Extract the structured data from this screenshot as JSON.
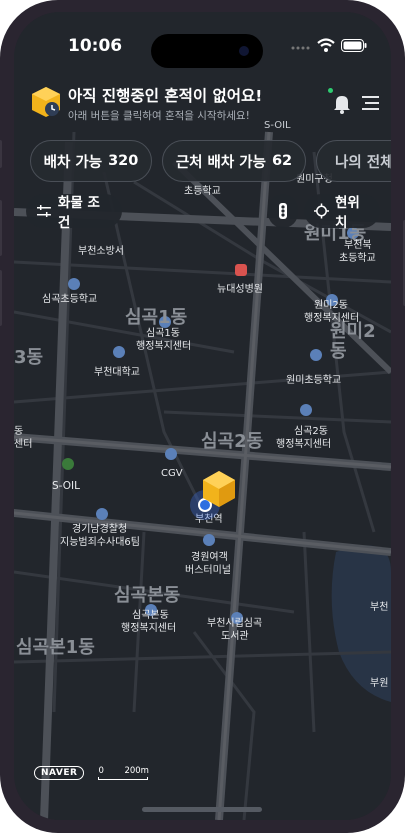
{
  "status_bar": {
    "time": "10:06"
  },
  "header": {
    "title": "아직 진행중인 혼적이 없어요!",
    "subtitle": "아래 버튼을 클릭하여 혼적을 시작하세요!"
  },
  "chips": [
    {
      "label": "배차 가능",
      "count": "320"
    },
    {
      "label": "근처 배차 가능",
      "count": "62"
    },
    {
      "label": "나의 전체",
      "count": ""
    }
  ],
  "toolbar": {
    "filter_label": "화물 조건",
    "location_label": "현위치"
  },
  "map": {
    "colors": {
      "land": "#22262c",
      "road": "#4a4e55",
      "main_road": "#5e6166",
      "label": "#e8eaed",
      "district": "#8a8f96",
      "poi_icon": "#5b80b8",
      "hospital": "#d9534f",
      "water": "#283446"
    },
    "places": {
      "oil_top": "S-OIL",
      "mingu": "원미구청",
      "bucheon_school": "초등학교",
      "wonmi1_partial": "원미1동",
      "bucheon_buk": "부천북",
      "bucheon_buk2": "초등학교",
      "fire": "부천소방서",
      "simgok_elem": "심곡초등학교",
      "new_hospital": "뉴대성병원",
      "wonmi2_center1": "원미2동",
      "wonmi2_center2": "행정복지센터",
      "wonmi2_district": "원미2동",
      "simgok1_district": "심곡1동",
      "simgok1_center1": "심곡1동",
      "simgok1_center2": "행정복지센터",
      "dong3_partial": "3동",
      "bucheon_univ": "부천대학교",
      "wonmi_elem": "원미초등학교",
      "simgok2_center1": "심곡2동",
      "simgok2_center2": "행정복지센터",
      "left_center1": "동",
      "left_center2": "센터",
      "simgok2_district": "심곡2동",
      "cgv": "CGV",
      "soil": "S-OIL",
      "bucheon_station": "부천역",
      "police1": "경기남경찰청",
      "police2": "지능범죄수사대6팀",
      "bus1": "경원여객",
      "bus2": "버스터미널",
      "simgokbon_district": "심곡본동",
      "simgokbon_center1": "심곡본동",
      "simgokbon_center2": "행정복지센터",
      "library1": "부천시립심곡",
      "library2": "도서관",
      "simgokbon1_district": "심곡본1동",
      "right_bucheon1": "부천",
      "right_bucheon2": "부원"
    }
  },
  "footer": {
    "naver_logo": "NAVER",
    "scale_zero": "0",
    "scale_dist": "200m"
  }
}
